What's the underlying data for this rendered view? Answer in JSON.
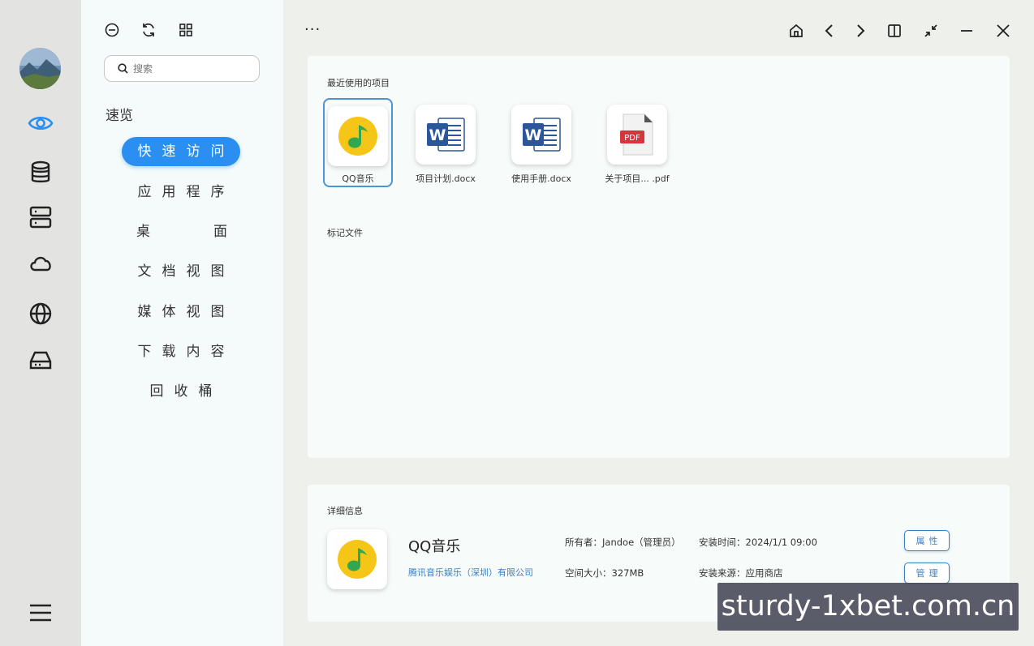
{
  "sidebar": {
    "search": {
      "placeholder": "搜索"
    },
    "section_label": "速览",
    "items": [
      {
        "label": "快速访问",
        "active": true
      },
      {
        "label": "应用程序"
      },
      {
        "label": "桌面",
        "left": "桌",
        "right": "面"
      },
      {
        "label": "文档视图"
      },
      {
        "label": "媒体视图"
      },
      {
        "label": "下载内容"
      },
      {
        "label": "回收桶"
      }
    ]
  },
  "topbar": {
    "more": "···"
  },
  "recent": {
    "title": "最近使用的项目",
    "files": [
      {
        "name": "QQ音乐",
        "icon": "qq-music-icon",
        "selected": true
      },
      {
        "name": "项目计划.docx",
        "icon": "word-icon"
      },
      {
        "name": "使用手册.docx",
        "icon": "word-icon"
      },
      {
        "name": "关于项目... .pdf",
        "icon": "pdf-icon"
      }
    ]
  },
  "tagged": {
    "title": "标记文件"
  },
  "details": {
    "title": "详细信息",
    "app_name": "QQ音乐",
    "publisher": "腾讯音乐娱乐（深圳）有限公司",
    "owner": "所有者：Jandoe（管理员）",
    "install_time": "安装时间：2024/1/1 09:00",
    "size": "空间大小：327MB",
    "source": "安装来源：应用商店",
    "properties_button": "属性",
    "manage_button": "管理"
  },
  "watermark": "sturdy-1xbet.com.cn",
  "colors": {
    "accent": "#2a8ff0",
    "link": "#3d7fc1",
    "word_blue": "#2b579a",
    "pdf_red": "#d9343b",
    "qq_yellow": "#f5c518",
    "qq_green": "#31a84f"
  }
}
